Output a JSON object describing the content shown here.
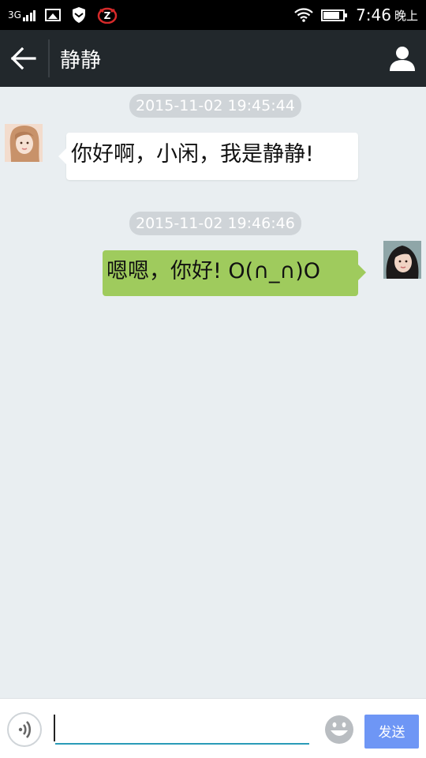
{
  "status_bar": {
    "network": "3G",
    "time": "7:46",
    "period": "晚上",
    "battery_level": 0.85,
    "signal_bars": 4
  },
  "header": {
    "title": "静静",
    "back_icon": "arrow-left-icon",
    "contact_icon": "person-icon"
  },
  "messages": [
    {
      "timestamp": "2015-11-02 19:45:44",
      "direction": "incoming",
      "text": "你好啊，小闲，我是静静!"
    },
    {
      "timestamp": "2015-11-02 19:46:46",
      "direction": "outgoing",
      "text": "嗯嗯，你好! O(∩_∩)O"
    }
  ],
  "composer": {
    "input_value": "",
    "send_label": "发送",
    "voice_icon": "voice-icon",
    "emoji_icon": "emoji-icon"
  },
  "colors": {
    "header_bg": "#22282c",
    "chat_bg": "#e9eef1",
    "outgoing_bubble": "#9fcb5d",
    "incoming_bubble": "#ffffff",
    "send_button": "#6e96f5",
    "input_underline": "#2a9bb8",
    "timestamp_bg": "#cfd4d8"
  }
}
